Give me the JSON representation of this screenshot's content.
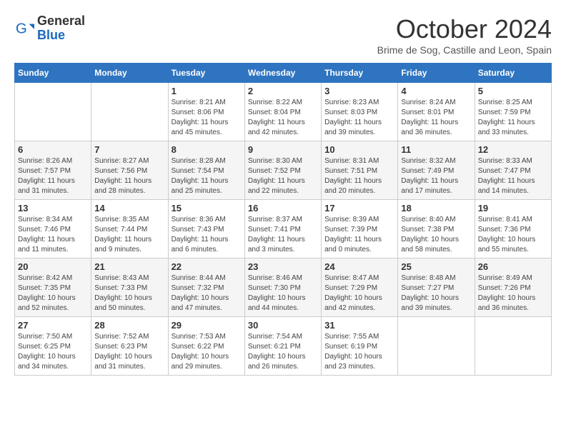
{
  "logo": {
    "general": "General",
    "blue": "Blue"
  },
  "header": {
    "month": "October 2024",
    "location": "Brime de Sog, Castille and Leon, Spain"
  },
  "weekdays": [
    "Sunday",
    "Monday",
    "Tuesday",
    "Wednesday",
    "Thursday",
    "Friday",
    "Saturday"
  ],
  "weeks": [
    [
      {
        "day": "",
        "sunrise": "",
        "sunset": "",
        "daylight": ""
      },
      {
        "day": "",
        "sunrise": "",
        "sunset": "",
        "daylight": ""
      },
      {
        "day": "1",
        "sunrise": "Sunrise: 8:21 AM",
        "sunset": "Sunset: 8:06 PM",
        "daylight": "Daylight: 11 hours and 45 minutes."
      },
      {
        "day": "2",
        "sunrise": "Sunrise: 8:22 AM",
        "sunset": "Sunset: 8:04 PM",
        "daylight": "Daylight: 11 hours and 42 minutes."
      },
      {
        "day": "3",
        "sunrise": "Sunrise: 8:23 AM",
        "sunset": "Sunset: 8:03 PM",
        "daylight": "Daylight: 11 hours and 39 minutes."
      },
      {
        "day": "4",
        "sunrise": "Sunrise: 8:24 AM",
        "sunset": "Sunset: 8:01 PM",
        "daylight": "Daylight: 11 hours and 36 minutes."
      },
      {
        "day": "5",
        "sunrise": "Sunrise: 8:25 AM",
        "sunset": "Sunset: 7:59 PM",
        "daylight": "Daylight: 11 hours and 33 minutes."
      }
    ],
    [
      {
        "day": "6",
        "sunrise": "Sunrise: 8:26 AM",
        "sunset": "Sunset: 7:57 PM",
        "daylight": "Daylight: 11 hours and 31 minutes."
      },
      {
        "day": "7",
        "sunrise": "Sunrise: 8:27 AM",
        "sunset": "Sunset: 7:56 PM",
        "daylight": "Daylight: 11 hours and 28 minutes."
      },
      {
        "day": "8",
        "sunrise": "Sunrise: 8:28 AM",
        "sunset": "Sunset: 7:54 PM",
        "daylight": "Daylight: 11 hours and 25 minutes."
      },
      {
        "day": "9",
        "sunrise": "Sunrise: 8:30 AM",
        "sunset": "Sunset: 7:52 PM",
        "daylight": "Daylight: 11 hours and 22 minutes."
      },
      {
        "day": "10",
        "sunrise": "Sunrise: 8:31 AM",
        "sunset": "Sunset: 7:51 PM",
        "daylight": "Daylight: 11 hours and 20 minutes."
      },
      {
        "day": "11",
        "sunrise": "Sunrise: 8:32 AM",
        "sunset": "Sunset: 7:49 PM",
        "daylight": "Daylight: 11 hours and 17 minutes."
      },
      {
        "day": "12",
        "sunrise": "Sunrise: 8:33 AM",
        "sunset": "Sunset: 7:47 PM",
        "daylight": "Daylight: 11 hours and 14 minutes."
      }
    ],
    [
      {
        "day": "13",
        "sunrise": "Sunrise: 8:34 AM",
        "sunset": "Sunset: 7:46 PM",
        "daylight": "Daylight: 11 hours and 11 minutes."
      },
      {
        "day": "14",
        "sunrise": "Sunrise: 8:35 AM",
        "sunset": "Sunset: 7:44 PM",
        "daylight": "Daylight: 11 hours and 9 minutes."
      },
      {
        "day": "15",
        "sunrise": "Sunrise: 8:36 AM",
        "sunset": "Sunset: 7:43 PM",
        "daylight": "Daylight: 11 hours and 6 minutes."
      },
      {
        "day": "16",
        "sunrise": "Sunrise: 8:37 AM",
        "sunset": "Sunset: 7:41 PM",
        "daylight": "Daylight: 11 hours and 3 minutes."
      },
      {
        "day": "17",
        "sunrise": "Sunrise: 8:39 AM",
        "sunset": "Sunset: 7:39 PM",
        "daylight": "Daylight: 11 hours and 0 minutes."
      },
      {
        "day": "18",
        "sunrise": "Sunrise: 8:40 AM",
        "sunset": "Sunset: 7:38 PM",
        "daylight": "Daylight: 10 hours and 58 minutes."
      },
      {
        "day": "19",
        "sunrise": "Sunrise: 8:41 AM",
        "sunset": "Sunset: 7:36 PM",
        "daylight": "Daylight: 10 hours and 55 minutes."
      }
    ],
    [
      {
        "day": "20",
        "sunrise": "Sunrise: 8:42 AM",
        "sunset": "Sunset: 7:35 PM",
        "daylight": "Daylight: 10 hours and 52 minutes."
      },
      {
        "day": "21",
        "sunrise": "Sunrise: 8:43 AM",
        "sunset": "Sunset: 7:33 PM",
        "daylight": "Daylight: 10 hours and 50 minutes."
      },
      {
        "day": "22",
        "sunrise": "Sunrise: 8:44 AM",
        "sunset": "Sunset: 7:32 PM",
        "daylight": "Daylight: 10 hours and 47 minutes."
      },
      {
        "day": "23",
        "sunrise": "Sunrise: 8:46 AM",
        "sunset": "Sunset: 7:30 PM",
        "daylight": "Daylight: 10 hours and 44 minutes."
      },
      {
        "day": "24",
        "sunrise": "Sunrise: 8:47 AM",
        "sunset": "Sunset: 7:29 PM",
        "daylight": "Daylight: 10 hours and 42 minutes."
      },
      {
        "day": "25",
        "sunrise": "Sunrise: 8:48 AM",
        "sunset": "Sunset: 7:27 PM",
        "daylight": "Daylight: 10 hours and 39 minutes."
      },
      {
        "day": "26",
        "sunrise": "Sunrise: 8:49 AM",
        "sunset": "Sunset: 7:26 PM",
        "daylight": "Daylight: 10 hours and 36 minutes."
      }
    ],
    [
      {
        "day": "27",
        "sunrise": "Sunrise: 7:50 AM",
        "sunset": "Sunset: 6:25 PM",
        "daylight": "Daylight: 10 hours and 34 minutes."
      },
      {
        "day": "28",
        "sunrise": "Sunrise: 7:52 AM",
        "sunset": "Sunset: 6:23 PM",
        "daylight": "Daylight: 10 hours and 31 minutes."
      },
      {
        "day": "29",
        "sunrise": "Sunrise: 7:53 AM",
        "sunset": "Sunset: 6:22 PM",
        "daylight": "Daylight: 10 hours and 29 minutes."
      },
      {
        "day": "30",
        "sunrise": "Sunrise: 7:54 AM",
        "sunset": "Sunset: 6:21 PM",
        "daylight": "Daylight: 10 hours and 26 minutes."
      },
      {
        "day": "31",
        "sunrise": "Sunrise: 7:55 AM",
        "sunset": "Sunset: 6:19 PM",
        "daylight": "Daylight: 10 hours and 23 minutes."
      },
      {
        "day": "",
        "sunrise": "",
        "sunset": "",
        "daylight": ""
      },
      {
        "day": "",
        "sunrise": "",
        "sunset": "",
        "daylight": ""
      }
    ]
  ]
}
